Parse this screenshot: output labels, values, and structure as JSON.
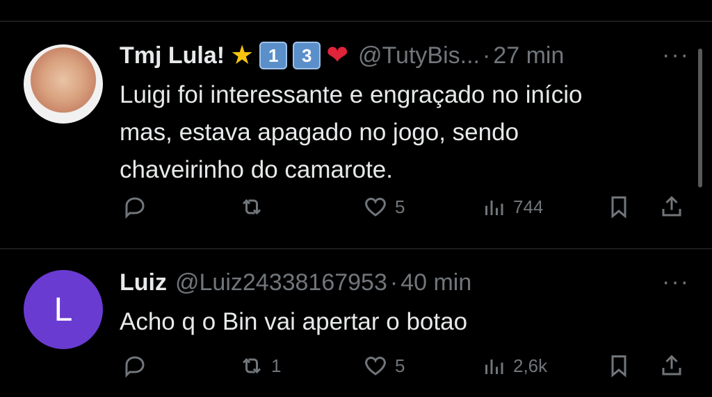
{
  "tweets": [
    {
      "name": "Tmj Lula!",
      "handle": "@TutyBis...",
      "separator": "·",
      "time": "27 min",
      "keycaps": [
        "1",
        "3"
      ],
      "text_lines": [
        "Luigi foi interessante e engraçado no início",
        "mas, estava apagado no jogo, sendo",
        "chaveirinho do camarote."
      ],
      "replies": "",
      "retweets": "",
      "likes": "5",
      "views": "744"
    },
    {
      "name": "Luiz",
      "avatar_letter": "L",
      "handle": "@Luiz24338167953",
      "separator": "·",
      "time": "40 min",
      "text_lines": [
        "Acho q o Bin vai apertar o botao"
      ],
      "replies": "",
      "retweets": "1",
      "likes": "5",
      "views": "2,6k"
    }
  ],
  "more_label": "···",
  "colors": {
    "background": "#000000",
    "text": "#e7e9ea",
    "muted": "#71767b",
    "avatar_purple": "#6a3bd1"
  }
}
